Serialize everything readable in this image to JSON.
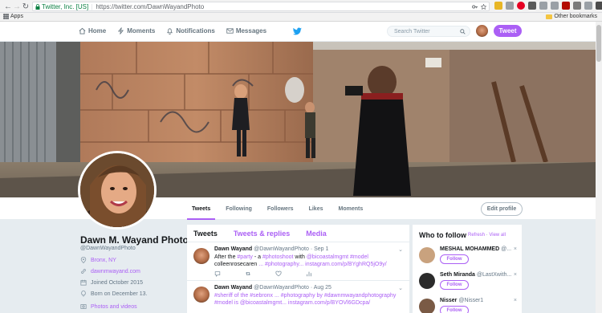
{
  "browser": {
    "back": "←",
    "forward": "→",
    "reload": "↻",
    "secure_label": "Twitter, Inc. [US]",
    "url": "https://twitter.com/DawnWayandPhoto",
    "apps_label": "Apps",
    "other_bookmarks_label": "Other bookmarks"
  },
  "topbar": {
    "nav": [
      {
        "label": "Home",
        "icon": "home-icon"
      },
      {
        "label": "Moments",
        "icon": "lightning-icon"
      },
      {
        "label": "Notifications",
        "icon": "bell-icon"
      },
      {
        "label": "Messages",
        "icon": "envelope-icon"
      }
    ],
    "search_placeholder": "Search Twitter",
    "tweet_button": "Tweet",
    "accent": "#ab5ff5"
  },
  "profile_nav": {
    "tabs": [
      {
        "label": "Tweets",
        "active": true
      },
      {
        "label": "Following"
      },
      {
        "label": "Followers"
      },
      {
        "label": "Likes"
      },
      {
        "label": "Moments"
      }
    ],
    "edit_profile": "Edit profile"
  },
  "profile": {
    "name": "Dawn M. Wayand Photo",
    "handle": "@DawnWayandPhoto",
    "location": "Bronx, NY",
    "website": "dawnmwayand.com",
    "joined": "Joined October 2015",
    "born": "Born on December 13.",
    "photos_videos": "Photos and videos"
  },
  "timeline": {
    "tabs": [
      {
        "label": "Tweets",
        "active": true
      },
      {
        "label": "Tweets & replies"
      },
      {
        "label": "Media"
      }
    ],
    "tweets": [
      {
        "name": "Dawn Wayand",
        "meta": "@DawnWayandPhoto · Sep 1",
        "line1_prefix": "After the ",
        "line1_tags": "#party",
        "line1_mid": " - a ",
        "line1_tag2": "#photoshoot",
        "line1_with": " with ",
        "line1_mention": "@bicoastalmgmt",
        "line1_tag3": " #model",
        "line2_prefix": "colleenrosecaren ",
        "line2_dots": "... ",
        "line2_tag": "#photography...",
        "line2_link": " instagram.com/p/BYghRQ5jO9y/"
      },
      {
        "name": "Dawn Wayand",
        "meta": "@DawnWayandPhoto · Aug 25",
        "line1": "#sheriff of the #sebronx ... #photography by #dawnmwayandphotography",
        "line2": "#model is @bicoastalmgmt... instagram.com/p/BYOVl6GDcpa/"
      }
    ]
  },
  "who_to_follow": {
    "title": "Who to follow",
    "refresh": "Refresh",
    "sep": " · ",
    "view_all": "View all",
    "follow_label": "Follow",
    "close": "×",
    "users": [
      {
        "name": "MESHAL MOHAMMED",
        "handle": "@...",
        "color": "#c9a27e"
      },
      {
        "name": "Seth Miranda",
        "handle": "@LastXwith...",
        "color": "#2b2b2b"
      },
      {
        "name": "Nisser",
        "handle": "@Nisser1",
        "color": "#7a5a45"
      }
    ]
  }
}
